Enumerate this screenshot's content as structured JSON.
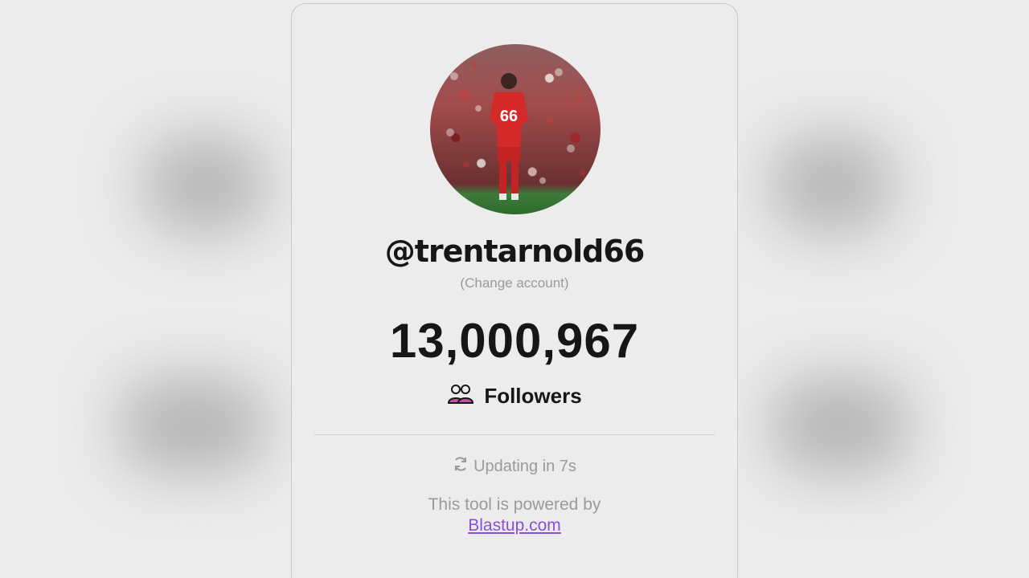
{
  "profile": {
    "handle": "@trentarnold66",
    "change_account": "(Change account)",
    "avatar_description_icon": "profile-photo"
  },
  "stats": {
    "follower_count": "13,000,967",
    "followers_label": "Followers"
  },
  "status": {
    "updating_text": "Updating in 7s"
  },
  "footer": {
    "powered_by": "This tool is powered by",
    "link_text": "Blastup.com"
  },
  "colors": {
    "background": "#ececec",
    "text": "#161616",
    "muted": "#9a9a9a",
    "link": "#8a4fd9",
    "followers_icon": "#c44fa8"
  }
}
